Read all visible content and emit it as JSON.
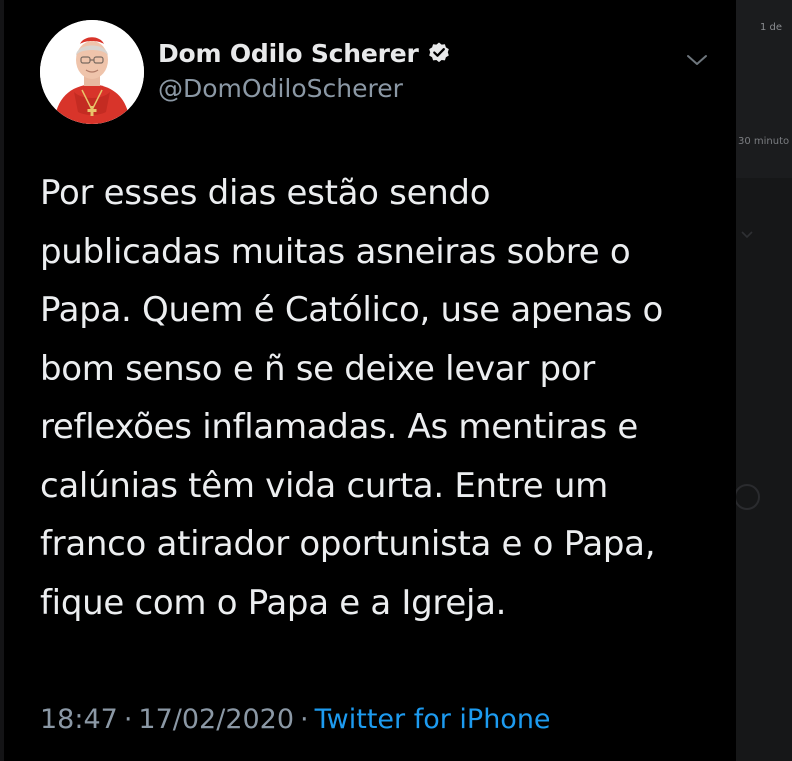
{
  "background": {
    "page_indicator": "1 de",
    "minutes_label": "30 minuto"
  },
  "tweet": {
    "display_name": "Dom Odilo Scherer",
    "handle": "@DomOdiloScherer",
    "verified": true,
    "text": "Por esses dias estão sendo\npublicadas muitas asneiras sobre o\nPapa. Quem é Católico, use apenas o\nbom senso e ñ se deixe levar por\nreflexões inflamadas. As mentiras e\ncalúnias têm vida curta. Entre um\nfranco atirador oportunista e o Papa,\nfique com o Papa e a Igreja.",
    "time": "18:47",
    "date": "17/02/2020",
    "separator": "·",
    "source": "Twitter for iPhone"
  },
  "icons": {
    "verified": "verified-badge-icon",
    "more": "chevron-down-icon"
  },
  "colors": {
    "background": "#000000",
    "text": "#eceef0",
    "muted": "#8b98a5",
    "link": "#1d9bf0",
    "cardinal_red": "#e0392b"
  }
}
